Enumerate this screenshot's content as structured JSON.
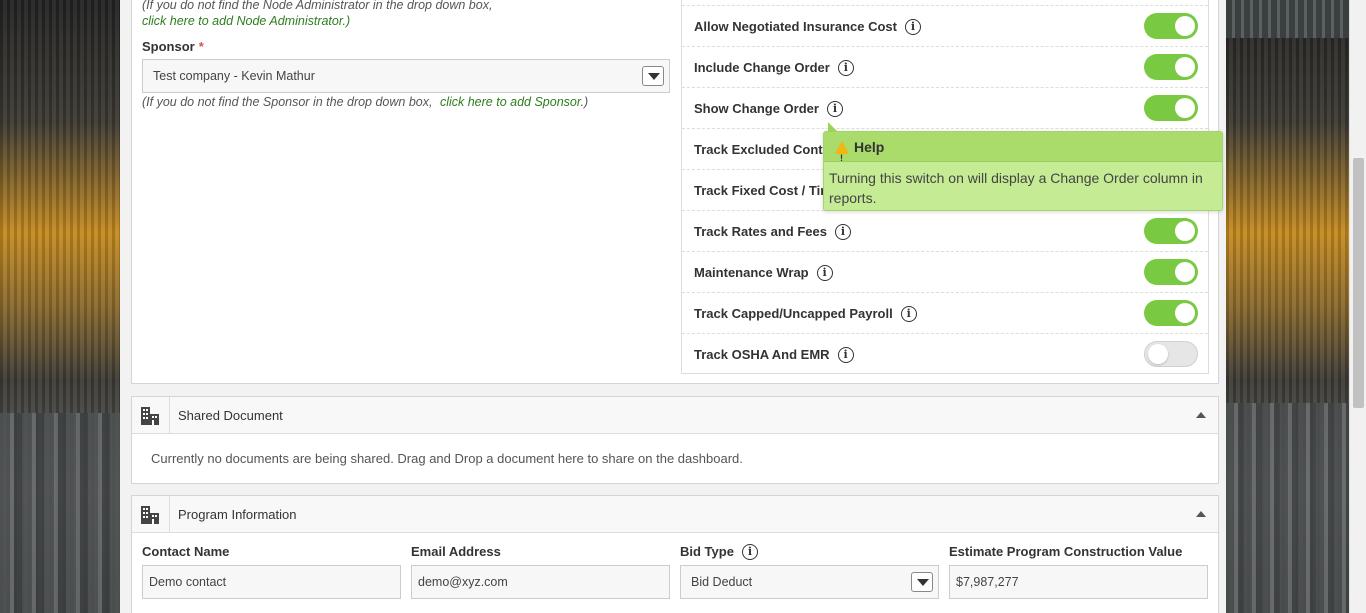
{
  "admin_note": {
    "line1": "(If you do not find the Node Administrator in the drop down box,",
    "link": "click here to add Node Administrator.)"
  },
  "sponsor": {
    "label": "Sponsor",
    "required_mark": "*",
    "value": "Test company - Kevin Mathur",
    "note_prefix": "(If you do not find the Sponsor in the drop down box,",
    "note_link": "click here to add Sponsor",
    "note_suffix": ".)"
  },
  "toggles": [
    {
      "label": "Allow Negotiated Insurance Cost",
      "on": true
    },
    {
      "label": "Include Change Order",
      "on": true
    },
    {
      "label": "Show Change Order",
      "on": true
    },
    {
      "label": "Track Excluded Contra",
      "on": true
    },
    {
      "label": "Track Fixed Cost / Tim",
      "on": true
    },
    {
      "label": "Track Rates and Fees",
      "on": true
    },
    {
      "label": "Maintenance Wrap",
      "on": true
    },
    {
      "label": "Track Capped/Uncapped Payroll",
      "on": true
    },
    {
      "label": "Track OSHA And EMR",
      "on": false
    }
  ],
  "tooltip": {
    "title": "Help",
    "text": "Turning this switch on will display a Change Order column in reports."
  },
  "shared_document": {
    "title": "Shared Document",
    "message": "Currently no documents are being shared. Drag and Drop a document here to share on the dashboard."
  },
  "program_information": {
    "title": "Program Information",
    "contact_name_label": "Contact Name",
    "contact_name_value": "Demo contact",
    "email_label": "Email Address",
    "email_value": "demo@xyz.com",
    "bid_type_label": "Bid Type",
    "bid_type_value": "Bid Deduct",
    "estimate_label": "Estimate Program Construction Value",
    "estimate_value": "$7,987,277"
  },
  "colors": {
    "switch_on": "#7ac943",
    "link_green": "#2e7d1e",
    "tooltip_bg": "#c5eb95",
    "required_red": "#d9534f"
  }
}
